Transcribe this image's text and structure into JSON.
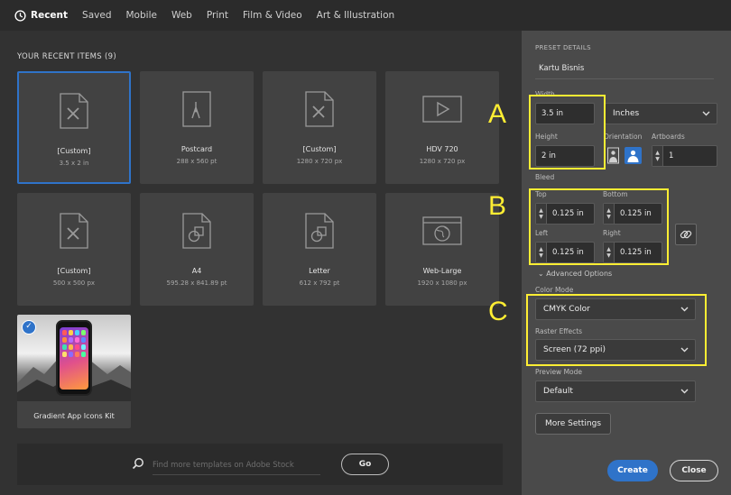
{
  "tabs": [
    {
      "label": "Recent",
      "active": true
    },
    {
      "label": "Saved"
    },
    {
      "label": "Mobile"
    },
    {
      "label": "Web"
    },
    {
      "label": "Print"
    },
    {
      "label": "Film & Video"
    },
    {
      "label": "Art & Illustration"
    }
  ],
  "recent": {
    "title": "YOUR RECENT ITEMS",
    "count": "(9)",
    "items": [
      {
        "name": "[Custom]",
        "size": "3.5 x 2 in",
        "icon": "brush-doc-icon",
        "selected": true
      },
      {
        "name": "Postcard",
        "size": "288 x 560 pt",
        "icon": "pen-doc-icon"
      },
      {
        "name": "[Custom]",
        "size": "1280 x 720 px",
        "icon": "brush-doc-icon"
      },
      {
        "name": "HDV 720",
        "size": "1280 x 720 px",
        "icon": "play-icon"
      },
      {
        "name": "[Custom]",
        "size": "500 x 500 px",
        "icon": "brush-doc-icon"
      },
      {
        "name": "A4",
        "size": "595.28 x 841.89 pt",
        "icon": "shapes-doc-icon"
      },
      {
        "name": "Letter",
        "size": "612 x 792 pt",
        "icon": "shapes-doc-icon"
      },
      {
        "name": "Web-Large",
        "size": "1920 x 1080 px",
        "icon": "globe-browser-icon"
      }
    ],
    "template": {
      "name": "Gradient App Icons Kit"
    }
  },
  "search": {
    "placeholder": "Find more templates on Adobe Stock",
    "go_label": "Go"
  },
  "preset": {
    "title": "PRESET DETAILS",
    "doc_name": "Kartu Bisnis",
    "width_label": "Width",
    "width": "3.5 in",
    "units": "Inches",
    "height_label": "Height",
    "height": "2 in",
    "orientation_label": "Orientation",
    "artboards_label": "Artboards",
    "artboards": "1",
    "bleed_label": "Bleed",
    "bleed": {
      "top_label": "Top",
      "top": "0.125 in",
      "bottom_label": "Bottom",
      "bottom": "0.125 in",
      "left_label": "Left",
      "left": "0.125 in",
      "right_label": "Right",
      "right": "0.125 in"
    },
    "advanced_label": "Advanced Options",
    "color_mode_label": "Color Mode",
    "color_mode": "CMYK Color",
    "raster_label": "Raster Effects",
    "raster": "Screen (72 ppi)",
    "preview_label": "Preview Mode",
    "preview": "Default",
    "more_settings": "More Settings",
    "create": "Create",
    "close": "Close"
  },
  "annotations": [
    "A",
    "B",
    "C"
  ],
  "colors": {
    "accent": "#2f73c9",
    "highlight": "#ffee33",
    "panel": "#4a4a4a",
    "background": "#323232"
  }
}
